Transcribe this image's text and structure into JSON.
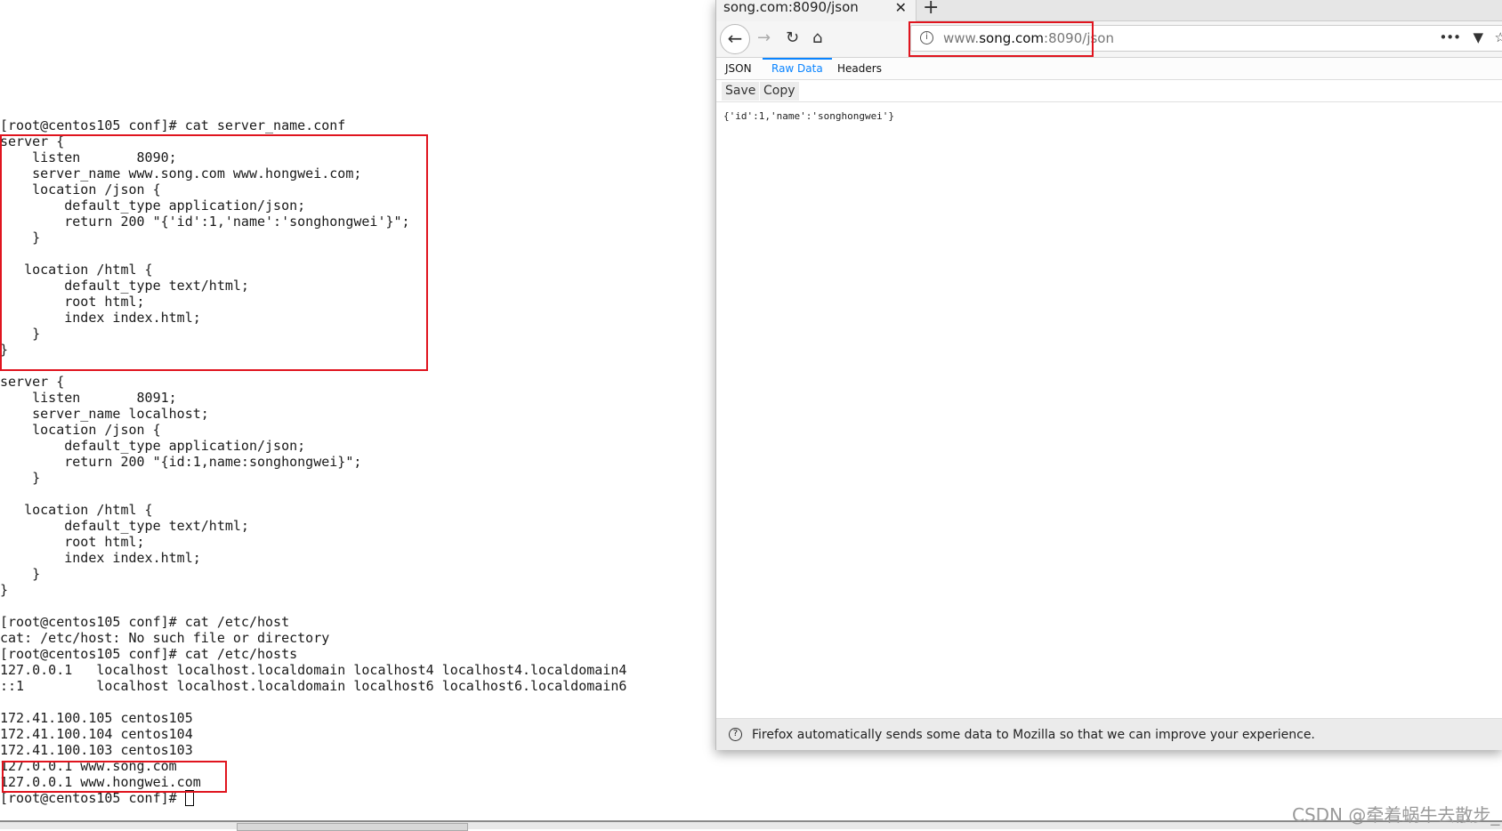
{
  "terminal": {
    "lines": [
      "[root@centos105 conf]# cat server_name.conf",
      "server {",
      "    listen       8090;",
      "    server_name www.song.com www.hongwei.com;",
      "    location /json {",
      "        default_type application/json;",
      "        return 200 \"{'id':1,'name':'songhongwei'}\";",
      "    }",
      "",
      "   location /html {",
      "        default_type text/html;",
      "        root html;",
      "        index index.html;",
      "    }",
      "}",
      "",
      "server {",
      "    listen       8091;",
      "    server_name localhost;",
      "    location /json {",
      "        default_type application/json;",
      "        return 200 \"{id:1,name:songhongwei}\";",
      "    }",
      "",
      "   location /html {",
      "        default_type text/html;",
      "        root html;",
      "        index index.html;",
      "    }",
      "}",
      "",
      "[root@centos105 conf]# cat /etc/host",
      "cat: /etc/host: No such file or directory",
      "[root@centos105 conf]# cat /etc/hosts",
      "127.0.0.1   localhost localhost.localdomain localhost4 localhost4.localdomain4",
      "::1         localhost localhost.localdomain localhost6 localhost6.localdomain6",
      "",
      "172.41.100.105 centos105",
      "172.41.100.104 centos104",
      "172.41.100.103 centos103",
      "127.0.0.1 www.song.com",
      "127.0.0.1 www.hongwei.com"
    ],
    "prompt": "[root@centos105 conf]# "
  },
  "browser": {
    "tab_title": "song.com:8090/json",
    "close": "✕",
    "new_tab": "+",
    "url_prefix": "www.",
    "url_domain": "song.com",
    "url_suffix": ":8090/json",
    "view_tabs": [
      "JSON",
      "Raw Data",
      "Headers"
    ],
    "active_view": "Raw Data",
    "save": "Save",
    "copy": "Copy",
    "raw_content": "{'id':1,'name':'songhongwei'}",
    "notification": "Firefox automatically sends some data to Mozilla so that we can improve your experience.",
    "accent": "#0a84ff"
  },
  "highlight_color": "#e0141e",
  "watermark": "CSDN @牵着蜗牛去散步_"
}
